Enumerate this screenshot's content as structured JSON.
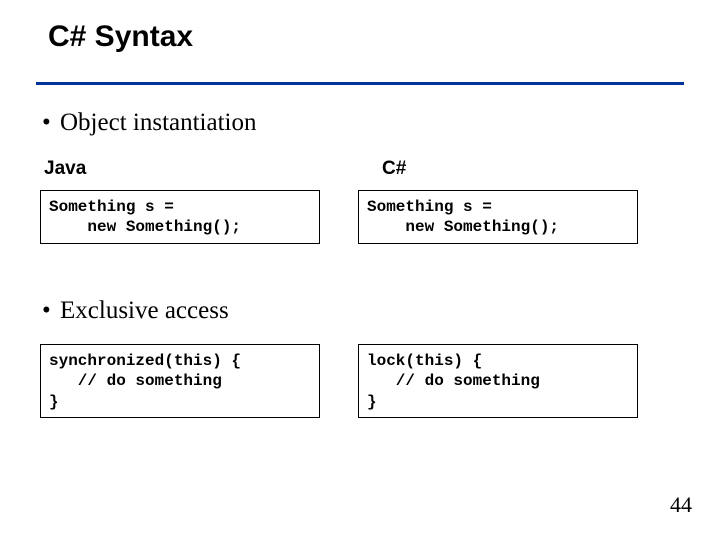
{
  "title": "C# Syntax",
  "bullets": {
    "b1": "Object instantiation",
    "b2": "Exclusive access"
  },
  "labels": {
    "java": "Java",
    "cs": "C#"
  },
  "code": {
    "java_instantiation": "Something s =\n    new Something();",
    "cs_instantiation": "Something s =\n    new Something();",
    "java_exclusive": "synchronized(this) {\n   // do something\n}",
    "cs_exclusive": "lock(this) {\n   // do something\n}"
  },
  "page_number": "44"
}
